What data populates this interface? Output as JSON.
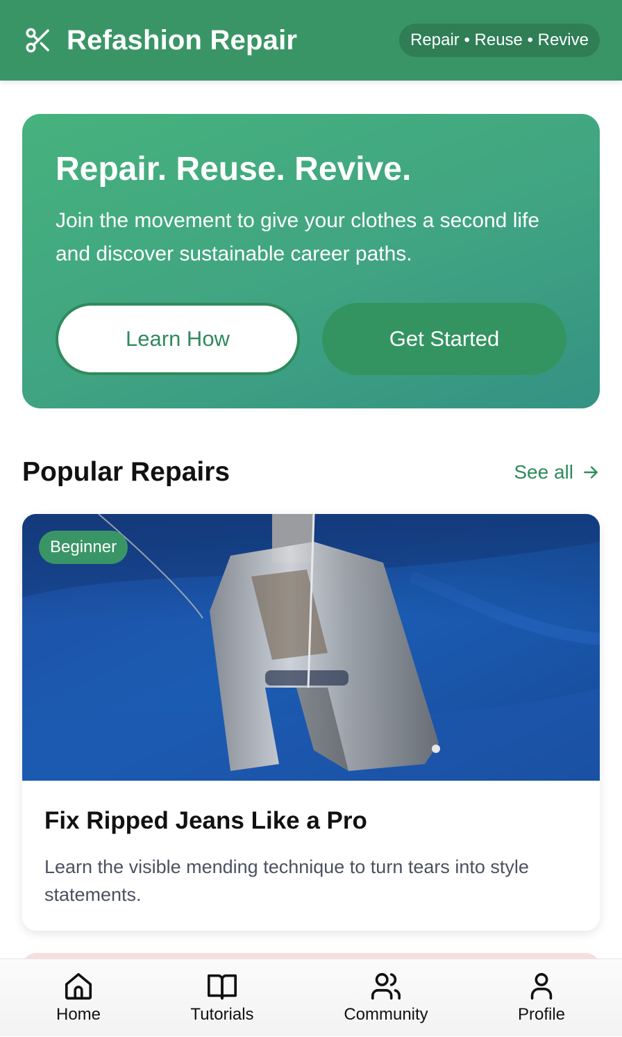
{
  "header": {
    "title": "Refashion Repair",
    "logo_icon": "scissors-icon",
    "tagline": "Repair • Reuse • Revive",
    "background_color": "#3a9566"
  },
  "hero": {
    "title": "Repair. Reuse. Revive.",
    "subtitle": "Join the movement to give your clothes a second life and discover sustainable career paths.",
    "learn_button": "Learn How",
    "start_button": "Get Started"
  },
  "popular": {
    "section_title": "Popular Repairs",
    "see_all_label": "See all",
    "see_all_icon": "arrow-right-icon",
    "cards": [
      {
        "level": "Beginner",
        "title": "Fix Ripped Jeans Like a Pro",
        "description": "Learn the visible mending technique to turn tears into style statements.",
        "image": "sewing-machine-presser-foot-on-blue-fabric"
      }
    ]
  },
  "bottom_nav": {
    "items": [
      {
        "label": "Home",
        "icon": "home-icon"
      },
      {
        "label": "Tutorials",
        "icon": "book-icon"
      },
      {
        "label": "Community",
        "icon": "users-icon"
      },
      {
        "label": "Profile",
        "icon": "user-icon"
      }
    ]
  },
  "colors": {
    "accent": "#2f8a5c",
    "hero_gradient_start": "#46b27d",
    "hero_gradient_end": "#349283"
  }
}
